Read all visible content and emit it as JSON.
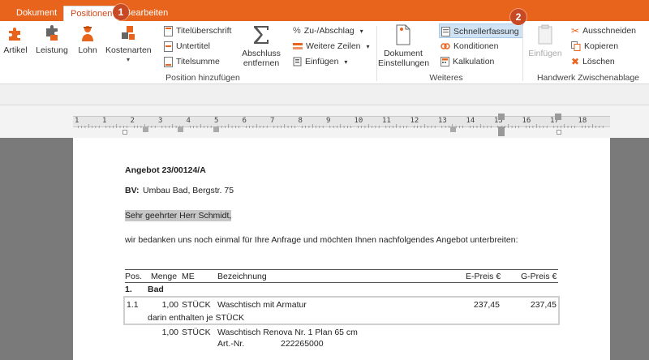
{
  "tabs": {
    "dokument": "Dokument",
    "positionen": "Positionen",
    "bearbeiten": "Bearbeiten"
  },
  "badges": {
    "one": "1",
    "two": "2"
  },
  "ribbon": {
    "artikel": "Artikel",
    "leistung": "Leistung",
    "lohn": "Lohn",
    "kostenarten": "Kostenarten",
    "titelueberschrift": "Titelüberschrift",
    "untertitel": "Untertitel",
    "titelsumme": "Titelsumme",
    "abschluss_l1": "Abschluss",
    "abschluss_l2": "entfernen",
    "zuabschlag": "Zu-/Abschlag",
    "weitere_zeilen": "Weitere Zeilen",
    "einfuegen_menu": "Einfügen",
    "dok_einst_l1": "Dokument",
    "dok_einst_l2": "Einstellungen",
    "schnellerfassung": "Schnellerfassung",
    "konditionen": "Konditionen",
    "kalkulation": "Kalkulation",
    "einfuegen": "Einfügen",
    "ausschneiden": "Ausschneiden",
    "kopieren": "Kopieren",
    "loeschen": "Löschen",
    "group_position": "Position hinzufügen",
    "group_weiteres": "Weiteres",
    "group_handwerk": "Handwerk Zwischenablage"
  },
  "ruler": [
    "1",
    "1",
    "2",
    "3",
    "4",
    "5",
    "6",
    "7",
    "8",
    "9",
    "10",
    "11",
    "12",
    "13",
    "14",
    "15",
    "16",
    "17",
    "18",
    "19"
  ],
  "document": {
    "title": "Angebot 23/00124/A",
    "bv_label": "BV:",
    "bv_value": "Umbau Bad, Bergstr. 75",
    "greeting": "Sehr geehrter Herr Schmidt,",
    "intro": "wir bedanken uns noch einmal für Ihre Anfrage und möchten Ihnen nachfolgendes Angebot unterbreiten:",
    "headers": {
      "pos": "Pos.",
      "menge": "Menge",
      "me": "ME",
      "bezeichnung": "Bezeichnung",
      "epreis": "E-Preis €",
      "gpreis": "G-Preis €"
    },
    "group": {
      "pos": "1.",
      "name": "Bad"
    },
    "row1": {
      "pos": "1.1",
      "menge": "1,00",
      "me": "STÜCK",
      "bez": "Waschtisch mit Armatur",
      "epreis": "237,45",
      "gpreis": "237,45"
    },
    "row1_sub": "darin enthalten je STÜCK",
    "row2": {
      "menge": "1,00",
      "me": "STÜCK",
      "bez": "Waschtisch Renova Nr. 1 Plan 65 cm",
      "art_label": "Art.-Nr.",
      "art_value": "222265000"
    }
  }
}
